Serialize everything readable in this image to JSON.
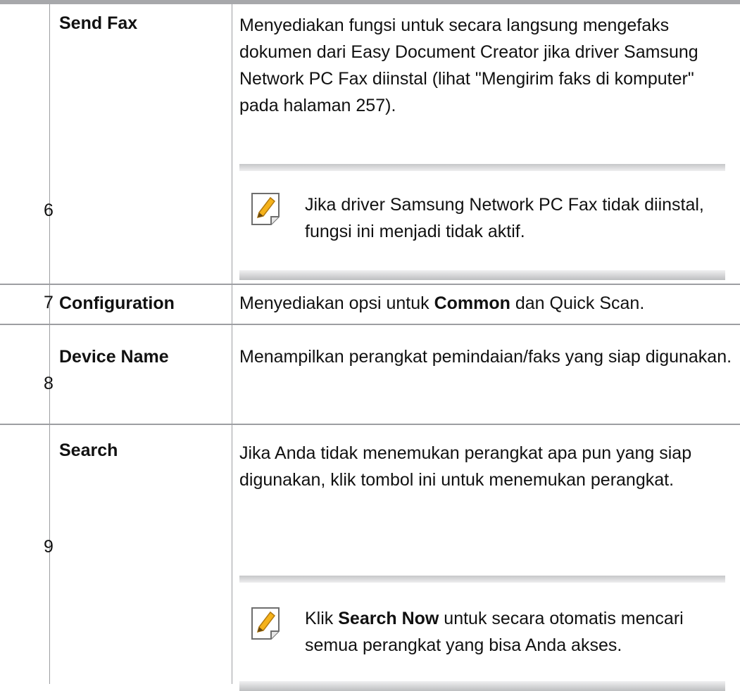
{
  "rows": [
    {
      "num": "6",
      "name": "Send Fax",
      "desc": "Menyediakan fungsi untuk secara langsung mengefaks dokumen dari Easy Document Creator jika driver Samsung Network PC Fax diinstal (lihat \"Mengirim faks di komputer\" pada halaman 257).",
      "note": "Jika driver Samsung Network PC Fax tidak diinstal, fungsi ini menjadi tidak aktif."
    },
    {
      "num": "7",
      "name": "Configuration",
      "desc_pre": "Menyediakan opsi untuk ",
      "desc_bold": "Common",
      "desc_post": " dan Quick Scan."
    },
    {
      "num": "8",
      "name": "Device Name",
      "desc": "Menampilkan perangkat pemindaian/faks yang siap digunakan."
    },
    {
      "num": "9",
      "name": "Search",
      "desc": "Jika Anda tidak menemukan perangkat apa pun yang siap digunakan, klik tombol ini untuk menemukan perangkat.",
      "note_pre": "Klik ",
      "note_bold": "Search Now",
      "note_post": " untuk secara otomatis mencari semua perangkat yang bisa Anda akses."
    }
  ],
  "icons": {
    "note": "note-pencil-icon"
  }
}
